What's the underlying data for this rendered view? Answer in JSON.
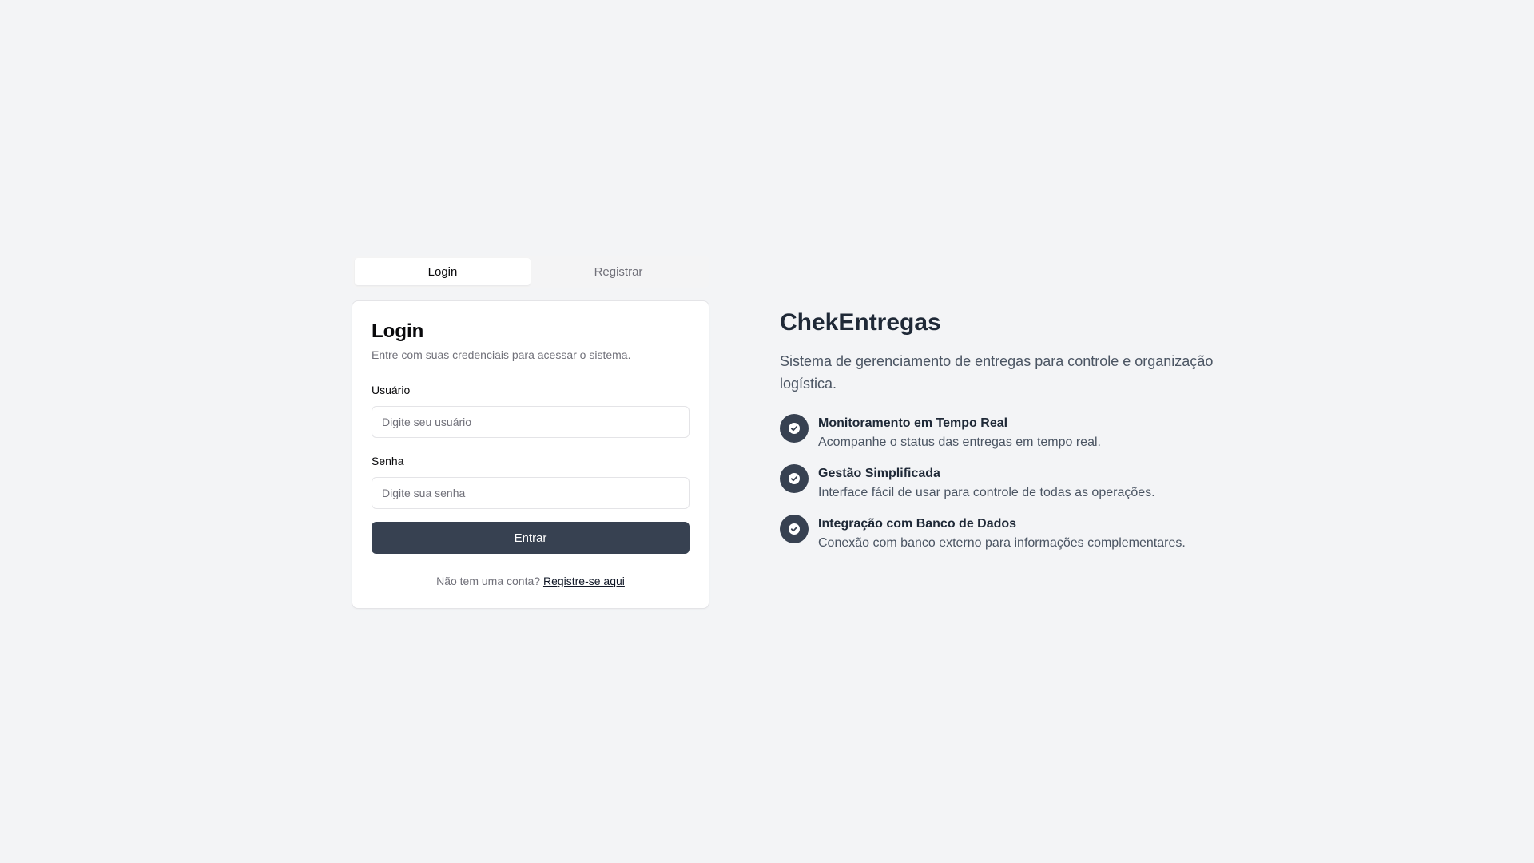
{
  "tabs": [
    {
      "label": "Login",
      "active": true
    },
    {
      "label": "Registrar",
      "active": false
    }
  ],
  "login_card": {
    "title": "Login",
    "description": "Entre com suas credenciais para acessar o sistema.",
    "username": {
      "label": "Usuário",
      "placeholder": "Digite seu usuário",
      "value": ""
    },
    "password": {
      "label": "Senha",
      "placeholder": "Digite sua senha",
      "value": ""
    },
    "submit_label": "Entrar",
    "footer_text": "Não tem uma conta?",
    "footer_link": "Registre-se aqui"
  },
  "info": {
    "brand": "ChekEntregas",
    "tagline": "Sistema de gerenciamento de entregas para controle e organização logística.",
    "features": [
      {
        "icon": "check-circle-icon",
        "title": "Monitoramento em Tempo Real",
        "description": "Acompanhe o status das entregas em tempo real."
      },
      {
        "icon": "check-circle-icon",
        "title": "Gestão Simplificada",
        "description": "Interface fácil de usar para controle de todas as operações."
      },
      {
        "icon": "check-circle-icon",
        "title": "Integração com Banco de Dados",
        "description": "Conexão com banco externo para informações complementares."
      }
    ]
  },
  "colors": {
    "background": "#f3f4f6",
    "primary_button": "#374151",
    "feature_icon_bg": "#374151"
  }
}
